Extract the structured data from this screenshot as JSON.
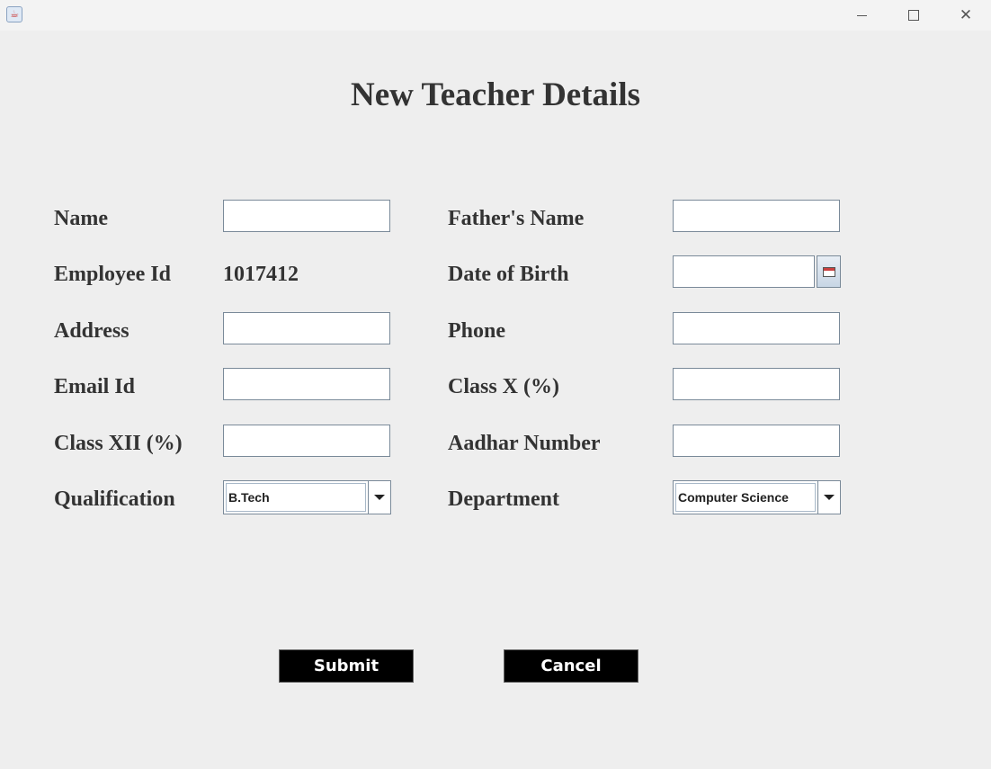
{
  "window": {
    "app_icon": "java-cup-icon",
    "minimize_icon": "minimize-icon",
    "maximize_icon": "maximize-icon",
    "close_icon": "close-icon"
  },
  "form": {
    "title": "New Teacher Details",
    "fields": {
      "name_label": "Name",
      "name_value": "",
      "fathers_name_label": "Father's Name",
      "fathers_name_value": "",
      "employee_id_label": "Employee Id",
      "employee_id_value": "1017412",
      "dob_label": "Date of Birth",
      "dob_value": "",
      "address_label": "Address",
      "address_value": "",
      "phone_label": "Phone",
      "phone_value": "",
      "email_label": "Email Id",
      "email_value": "",
      "class_x_label": "Class X (%)",
      "class_x_value": "",
      "class_xii_label": "Class XII (%)",
      "class_xii_value": "",
      "aadhar_label": "Aadhar Number",
      "aadhar_value": "",
      "qualification_label": "Qualification",
      "qualification_selected": "B.Tech",
      "department_label": "Department",
      "department_selected": "Computer Science"
    },
    "buttons": {
      "submit_label": "Submit",
      "cancel_label": "Cancel"
    }
  },
  "colors": {
    "background": "#eeeeee",
    "button_bg": "#000000",
    "button_text": "#ffffff",
    "label_text": "#333333"
  }
}
